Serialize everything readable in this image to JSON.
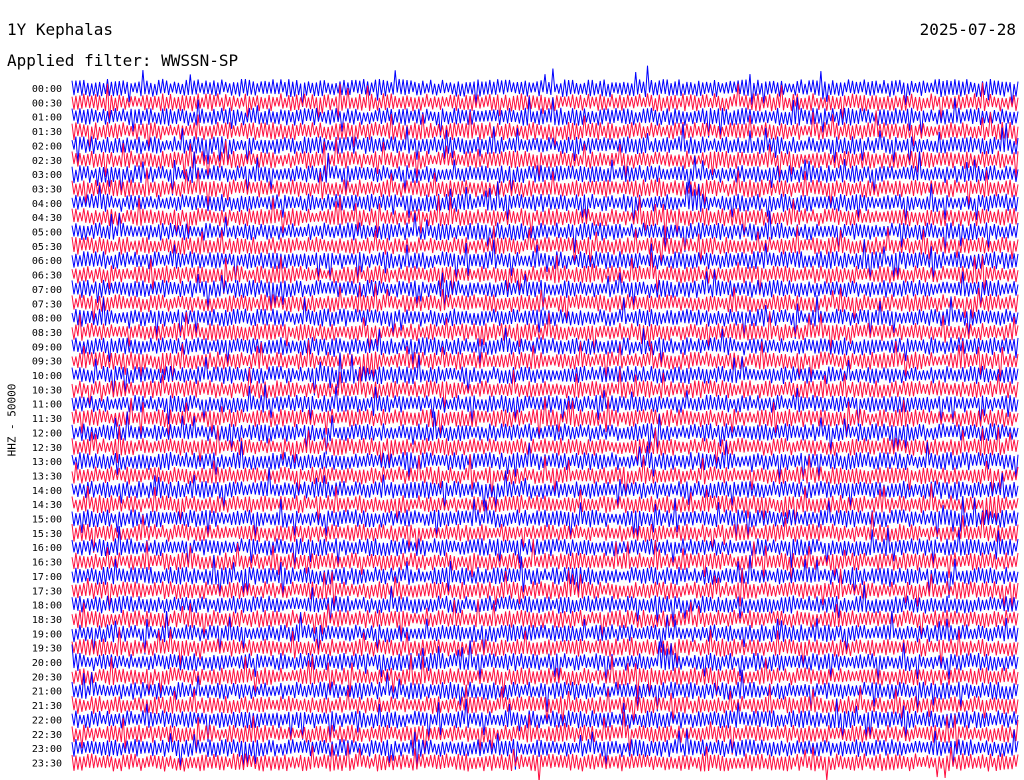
{
  "header": {
    "station": "1Y Kephalas",
    "filter": "Applied filter: WWSSN-SP",
    "date": "2025-07-28"
  },
  "chart_data": {
    "type": "line",
    "title": "1Y Kephalas",
    "ylabel": "HHZ - 50000",
    "row_labels": [
      "00:00",
      "00:30",
      "01:00",
      "01:30",
      "02:00",
      "02:30",
      "03:00",
      "03:30",
      "04:00",
      "04:30",
      "05:00",
      "05:30",
      "06:00",
      "06:30",
      "07:00",
      "07:30",
      "08:00",
      "08:30",
      "09:00",
      "09:30",
      "10:00",
      "10:30",
      "11:00",
      "11:30",
      "12:00",
      "12:30",
      "13:00",
      "13:30",
      "14:00",
      "14:30",
      "15:00",
      "15:30",
      "16:00",
      "16:30",
      "17:00",
      "17:30",
      "18:00",
      "18:30",
      "19:00",
      "19:30",
      "20:00",
      "20:30",
      "21:00",
      "21:30",
      "22:00",
      "22:30",
      "23:00",
      "23:30"
    ],
    "row_colors": [
      "#0000ff",
      "#ff1040"
    ],
    "grid": false
  }
}
